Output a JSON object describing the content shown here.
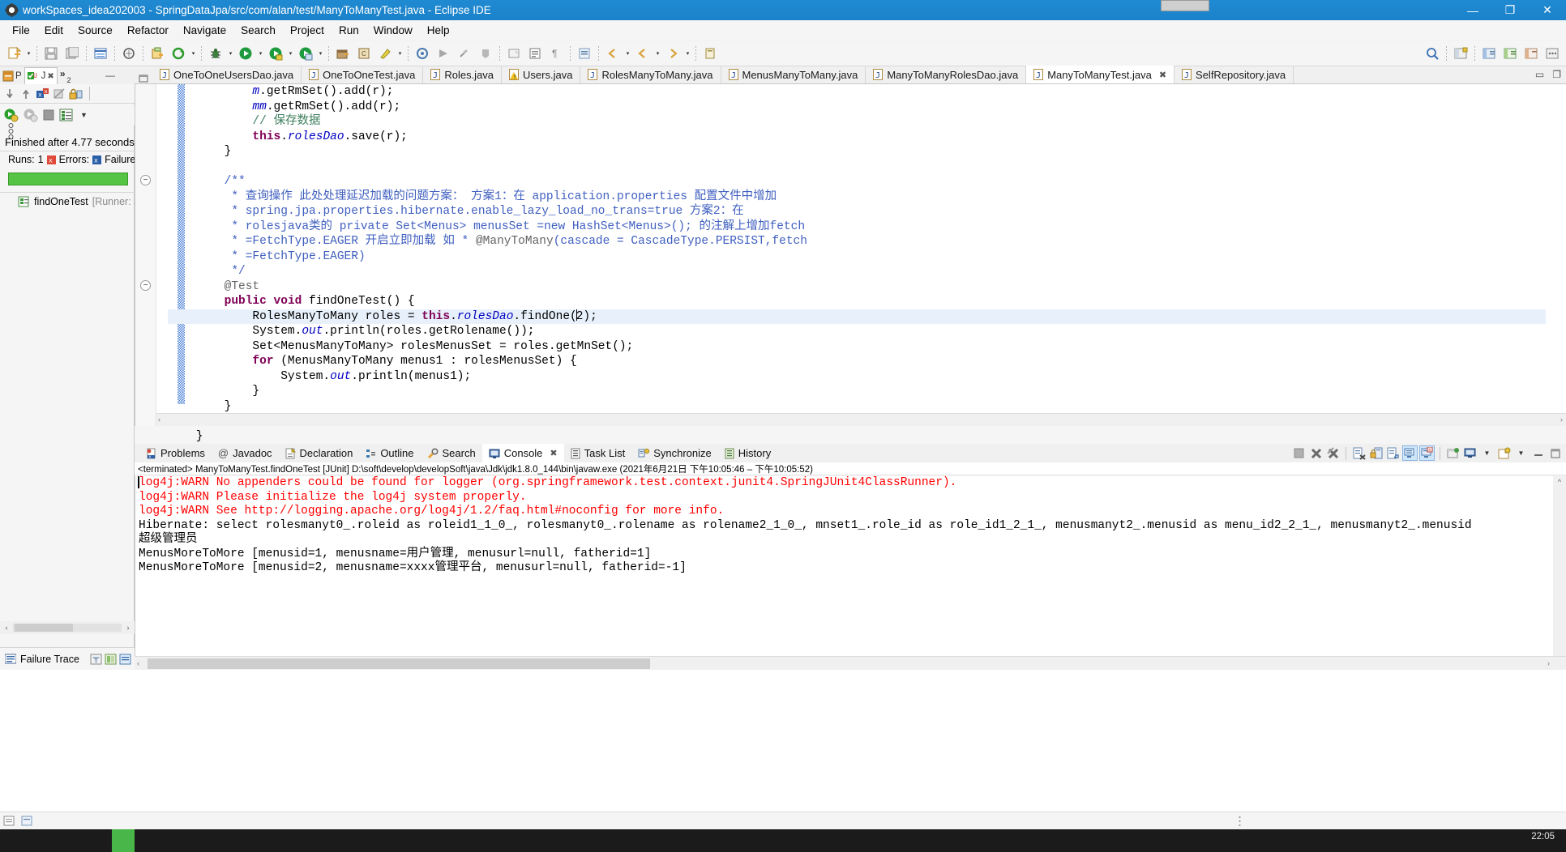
{
  "window": {
    "title": "workSpaces_idea202003 - SpringDataJpa/src/com/alan/test/ManyToManyTest.java - Eclipse IDE",
    "app_icon": "eclipse-icon",
    "minimize": "—",
    "maximize": "❐",
    "close": "✕"
  },
  "menubar": {
    "items": [
      {
        "label": "File"
      },
      {
        "label": "Edit"
      },
      {
        "label": "Source"
      },
      {
        "label": "Refactor"
      },
      {
        "label": "Navigate"
      },
      {
        "label": "Search"
      },
      {
        "label": "Project"
      },
      {
        "label": "Run"
      },
      {
        "label": "Window"
      },
      {
        "label": "Help"
      }
    ]
  },
  "junit_view": {
    "tabs": [
      {
        "label": "P",
        "icon": "package-explorer-icon",
        "active": false
      },
      {
        "label": "J",
        "icon": "junit-icon",
        "active": true
      }
    ],
    "overflow_label": "»",
    "overflow_count": "2",
    "minimize": "—",
    "status": "Finished after 4.77 seconds",
    "counts": {
      "runs_label": "Runs:",
      "runs_value": "1",
      "errors_label": "Errors:",
      "errors_value": "",
      "failures_label": "Failures:",
      "failures_value": ""
    },
    "progress_color": "#55c344",
    "tree_item": {
      "name": "findOneTest",
      "suffix": "[Runner: JUni"
    },
    "failure_trace_label": "Failure Trace",
    "toolbar_icons": [
      "next-failure-icon",
      "previous-failure-icon",
      "show-failures-only-icon",
      "stop-icon",
      "lock-icon",
      "rerun-test-icon",
      "rerun-failed-icon",
      "terminate-icon",
      "test-run-history-icon",
      "view-menu-icon"
    ],
    "failure_trace_icons": [
      "filter-stack-trace-icon",
      "compare-result-icon",
      "stack-trace-menu-icon"
    ]
  },
  "editor": {
    "tabs": [
      {
        "label": "OneToOneUsersDao.java",
        "icon": "java-file-icon",
        "active": false,
        "closable": false
      },
      {
        "label": "OneToOneTest.java",
        "icon": "java-file-icon",
        "active": false,
        "closable": false
      },
      {
        "label": "Roles.java",
        "icon": "java-file-icon",
        "active": false,
        "closable": false
      },
      {
        "label": "Users.java",
        "icon": "java-warning-file-icon",
        "active": false,
        "closable": false
      },
      {
        "label": "RolesManyToMany.java",
        "icon": "java-file-icon",
        "active": false,
        "closable": false
      },
      {
        "label": "MenusManyToMany.java",
        "icon": "java-file-icon",
        "active": false,
        "closable": false
      },
      {
        "label": "ManyToManyRolesDao.java",
        "icon": "java-file-icon",
        "active": false,
        "closable": false
      },
      {
        "label": "ManyToManyTest.java",
        "icon": "java-file-icon",
        "active": true,
        "closable": true
      },
      {
        "label": "SelfRepository.java",
        "icon": "java-file-icon",
        "active": false,
        "closable": false
      }
    ],
    "tab_close_glyph": "✖",
    "code_lines": [
      {
        "indent": 0,
        "html": "            <span class=\"stat\">m</span>.getRmSet().add(r);"
      },
      {
        "indent": 0,
        "html": "            <span class=\"stat\">mm</span>.getRmSet().add(r);"
      },
      {
        "indent": 0,
        "html": "            <span class=\"cmt\">// 保存数据</span>"
      },
      {
        "indent": 0,
        "html": "            <span class=\"kw\">this</span>.<span class=\"fld\">rolesDao</span>.save(r);"
      },
      {
        "indent": 0,
        "html": "        }"
      },
      {
        "indent": 0,
        "html": ""
      },
      {
        "indent": 0,
        "html": "        <span class=\"jdoc\">/**</span>",
        "fold": true
      },
      {
        "indent": 0,
        "html": "         <span class=\"jdoc\">* 查询操作 此处处理延迟加载的问题方案： 方案1：在 application.properties 配置文件中增加</span>"
      },
      {
        "indent": 0,
        "html": "         <span class=\"jdoc\">* spring.jpa.properties.hibernate.enable_lazy_load_no_trans=true 方案2：在</span>"
      },
      {
        "indent": 0,
        "html": "         <span class=\"jdoc\">* rolesjava类的 private Set&lt;Menus&gt; menusSet =new HashSet&lt;Menus&gt;(); 的注解上增加fetch</span>"
      },
      {
        "indent": 0,
        "html": "         <span class=\"jdoc\">* =FetchType.EAGER 开启立即加载 如 * <span class=\"ann\">@ManyToMany</span>(cascade = CascadeType.PERSIST,fetch</span>"
      },
      {
        "indent": 0,
        "html": "         <span class=\"jdoc\">* =FetchType.EAGER)</span>"
      },
      {
        "indent": 0,
        "html": "         <span class=\"jdoc\">*/</span>"
      },
      {
        "indent": 0,
        "html": "        <span class=\"ann\">@Test</span>",
        "fold": true
      },
      {
        "indent": 0,
        "html": "        <span class=\"kw\">public</span> <span class=\"kw\">void</span> findOneTest() {"
      },
      {
        "indent": 0,
        "html": "            RolesManyToMany roles = <span class=\"kw\">this</span>.<span class=\"fld\">rolesDao</span>.findOne(<span class=\"caret\"></span>2);",
        "hl": true
      },
      {
        "indent": 0,
        "html": "            System.<span class=\"fld\">out</span>.println(roles.getRolename());"
      },
      {
        "indent": 0,
        "html": "            Set&lt;MenusManyToMany&gt; rolesMenusSet = roles.getMnSet();"
      },
      {
        "indent": 0,
        "html": "            <span class=\"kw\">for</span> (MenusManyToMany menus1 : rolesMenusSet) {"
      },
      {
        "indent": 0,
        "html": "                System.<span class=\"fld\">out</span>.println(menus1);"
      },
      {
        "indent": 0,
        "html": "            }"
      },
      {
        "indent": 0,
        "html": "        }"
      },
      {
        "indent": 0,
        "html": ""
      },
      {
        "indent": 0,
        "html": "    }"
      }
    ],
    "plain_code_lines": [
      "m.getRmSet().add(r);",
      "mm.getRmSet().add(r);",
      "// 保存数据",
      "this.rolesDao.save(r);",
      "}",
      "",
      "/**",
      "* 查询操作 此处处理延迟加载的问题方案： 方案1：在 application.properties 配置文件中增加",
      "* spring.jpa.properties.hibernate.enable_lazy_load_no_trans=true 方案2：在",
      "* rolesjava类的 private Set<Menus> menusSet =new HashSet<Menus>(); 的注解上增加fetch",
      "* =FetchType.EAGER 开启立即加载 如 * @ManyToMany(cascade = CascadeType.PERSIST,fetch",
      "* =FetchType.EAGER)",
      "*/",
      "@Test",
      "public void findOneTest() {",
      "RolesManyToMany roles = this.rolesDao.findOne(2);",
      "System.out.println(roles.getRolename());",
      "Set<MenusManyToMany> rolesMenusSet = roles.getMnSet();",
      "for (MenusManyToMany menus1 : rolesMenusSet) {",
      "System.out.println(menus1);",
      "}",
      "}",
      "",
      "}"
    ]
  },
  "bottom_panel": {
    "tabs": [
      {
        "label": "Problems",
        "icon": "problems-icon",
        "active": false
      },
      {
        "label": "Javadoc",
        "icon": "javadoc-icon",
        "active": false
      },
      {
        "label": "Declaration",
        "icon": "declaration-icon",
        "active": false
      },
      {
        "label": "Outline",
        "icon": "outline-icon",
        "active": false
      },
      {
        "label": "Search",
        "icon": "search-icon",
        "active": false
      },
      {
        "label": "Console",
        "icon": "console-icon",
        "active": true,
        "closable": true
      },
      {
        "label": "Task List",
        "icon": "task-list-icon",
        "active": false
      },
      {
        "label": "Synchronize",
        "icon": "synchronize-icon",
        "active": false
      },
      {
        "label": "History",
        "icon": "history-icon",
        "active": false
      }
    ],
    "tab_close_glyph": "✖",
    "toolbar_icons": [
      "terminate-icon",
      "remove-launch-icon",
      "remove-all-terminated-icon",
      "clear-console-icon",
      "scroll-lock-icon",
      "word-wrap-icon",
      "show-console-on-output-icon",
      "show-console-on-error-icon",
      "pin-console-icon",
      "display-selected-console-icon",
      "display-selected-console-menu-icon",
      "open-console-icon",
      "open-console-menu-icon",
      "minimize-icon",
      "maximize-icon"
    ],
    "process_header": "<terminated> ManyToManyTest.findOneTest [JUnit] D:\\soft\\develop\\developSoft\\java\\Jdk\\jdk1.8.0_144\\bin\\javaw.exe  (2021年6月21日 下午10:05:46 – 下午10:05:52)",
    "console_lines": [
      {
        "text": "log4j:WARN No appenders could be found for logger (org.springframework.test.context.junit4.SpringJUnit4ClassRunner).",
        "color": "error"
      },
      {
        "text": "log4j:WARN Please initialize the log4j system properly.",
        "color": "error"
      },
      {
        "text": "log4j:WARN See http://logging.apache.org/log4j/1.2/faq.html#noconfig for more info.",
        "color": "error"
      },
      {
        "text": "Hibernate: select rolesmanyt0_.roleid as roleid1_1_0_, rolesmanyt0_.rolename as rolename2_1_0_, mnset1_.role_id as role_id1_2_1_, menusmanyt2_.menusid as menu_id2_2_1_, menusmanyt2_.menusid",
        "color": "normal"
      },
      {
        "text": "超级管理员",
        "color": "normal"
      },
      {
        "text": "MenusMoreToMore [menusid=1, menusname=用户管理, menusurl=null, fatherid=1]",
        "color": "normal"
      },
      {
        "text": "MenusMoreToMore [menusid=2, menusname=xxxx管理平台, menusurl=null, fatherid=-1]",
        "color": "normal"
      }
    ],
    "error_color": "#ff0000"
  },
  "statusbar": {
    "items": [
      "writable-indicator",
      "insert-mode-indicator"
    ]
  },
  "taskbar": {
    "clock_time": "22:05",
    "clock_date": ""
  }
}
